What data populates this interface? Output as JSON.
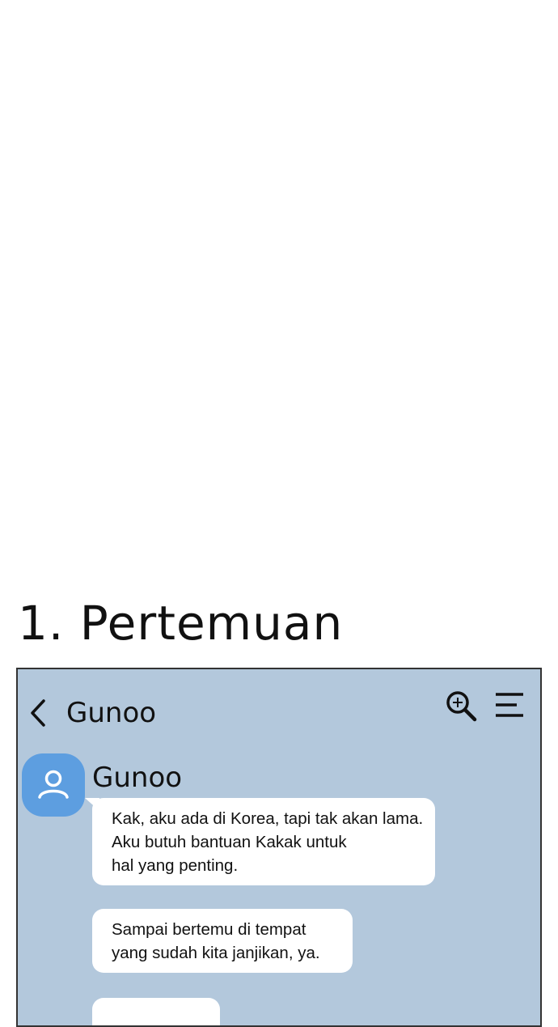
{
  "chapter": {
    "title": "1. Pertemuan"
  },
  "chat": {
    "header": {
      "title": "Gunoo",
      "back_icon": "chevron-left-icon",
      "search_icon": "zoom-in-icon",
      "menu_icon": "hamburger-menu-icon"
    },
    "sender": {
      "name": "Gunoo",
      "avatar_icon": "person-icon"
    },
    "messages": [
      {
        "lines": [
          "Kak, aku ada di Korea, tapi tak akan lama.",
          "Aku butuh bantuan Kakak untuk",
          "hal yang penting."
        ]
      },
      {
        "lines": [
          "Sampai bertemu di tempat",
          "yang sudah kita janjikan, ya."
        ]
      },
      {
        "lines": []
      }
    ]
  },
  "colors": {
    "chat_background": "#b3c8dc",
    "avatar": "#5d9ee0",
    "bubble": "#ffffff",
    "frame_border": "#333333"
  }
}
